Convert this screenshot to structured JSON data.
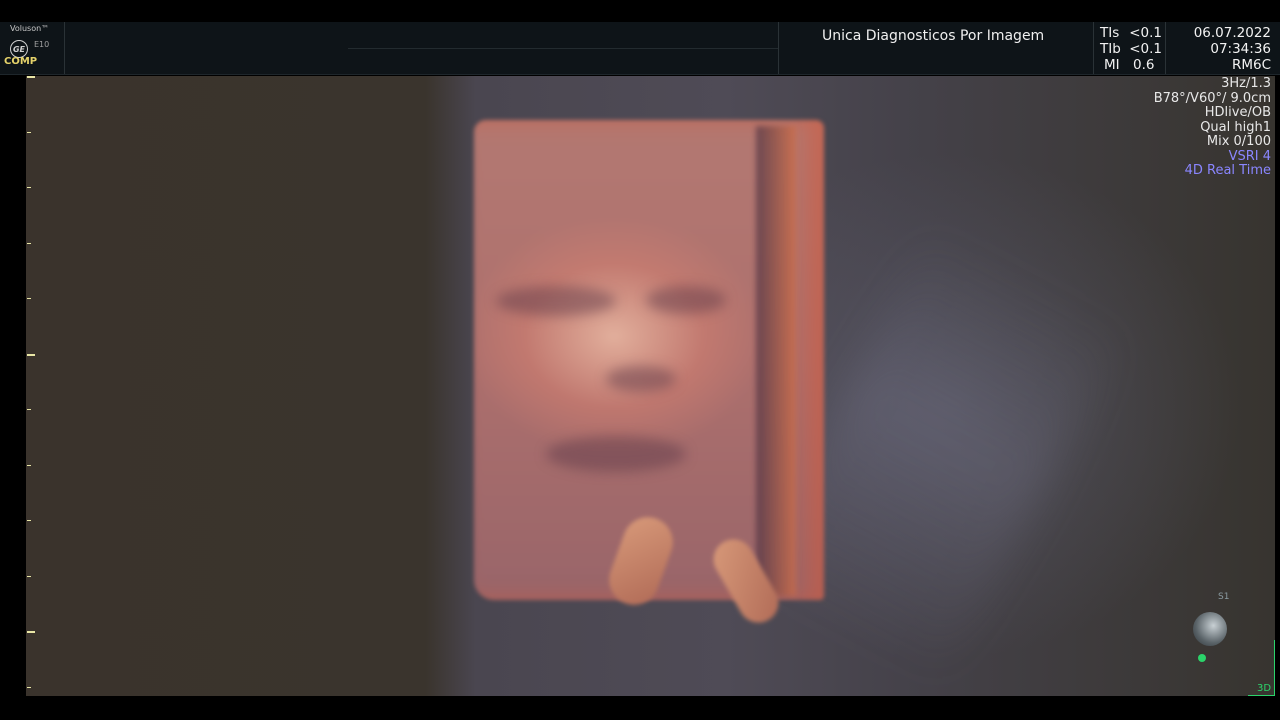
{
  "header": {
    "brand": "Voluson™",
    "logo_text": "GE",
    "model": "E10",
    "comp_label": "COMP",
    "clinic_name": "Unica Diagnosticos Por Imagem",
    "ti": [
      {
        "label": "TIs",
        "value": "<0.1"
      },
      {
        "label": "TIb",
        "value": "<0.1"
      },
      {
        "label": "MI",
        "value": "0.6"
      }
    ],
    "date": "06.07.2022",
    "time": "07:34:36",
    "probe": "RM6C"
  },
  "info_panel": {
    "frame_rate": "3Hz/1.3",
    "angles": "B78°/V60°/ 9.0cm",
    "render": "HDlive/OB",
    "quality": "Qual high1",
    "mix": "Mix 0/100",
    "vsri": "VSRI 4",
    "mode": "4D Real Time"
  },
  "orientation": {
    "label": "S1",
    "mode_label": "3D"
  },
  "colors": {
    "accent_blue": "#8a86ff",
    "mode_green": "#2bd36a",
    "comp_yellow": "#e6d36a"
  }
}
